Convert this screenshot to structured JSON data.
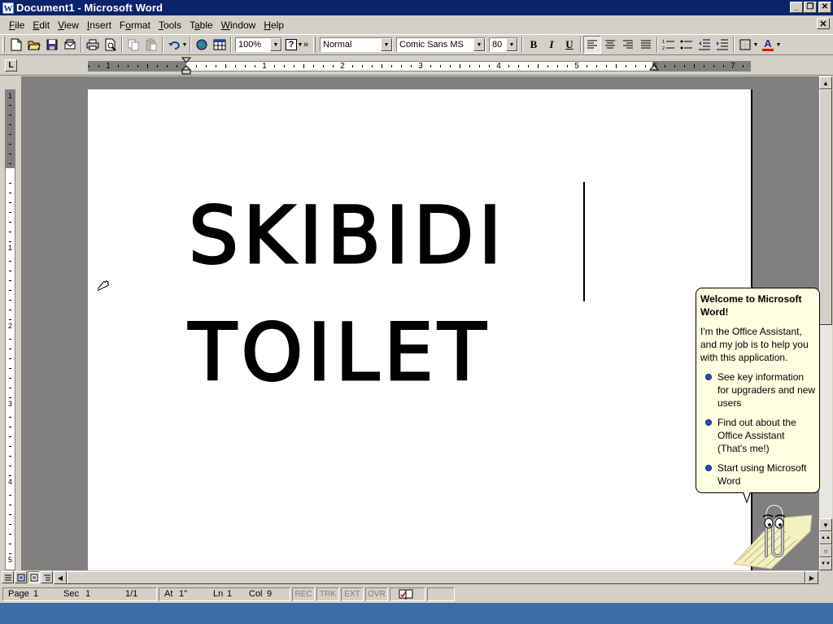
{
  "window": {
    "title": "Document1 - Microsoft Word",
    "app_icon": "W",
    "buttons": {
      "minimize": "_",
      "maximize": "❐",
      "close": "✕"
    }
  },
  "menu": {
    "items": [
      {
        "label": "File",
        "key": "F",
        "rest": "ile"
      },
      {
        "label": "Edit",
        "key": "E",
        "rest": "dit"
      },
      {
        "label": "View",
        "key": "V",
        "rest": "iew"
      },
      {
        "label": "Insert",
        "key": "I",
        "rest": "nsert"
      },
      {
        "label": "Format",
        "key": "F",
        "rest": "ormat",
        "pre": ""
      },
      {
        "label": "Tools",
        "key": "T",
        "rest": "ools"
      },
      {
        "label": "Table",
        "key": "a",
        "pre": "T",
        "rest": "ble"
      },
      {
        "label": "Window",
        "key": "W",
        "rest": "indow"
      },
      {
        "label": "Help",
        "key": "H",
        "rest": "elp"
      }
    ],
    "doc_close": "✕"
  },
  "toolbar": {
    "zoom": "100%",
    "help_glyph": "?",
    "more": "»",
    "style": "Normal",
    "font": "Comic Sans MS",
    "size": "80",
    "bold": "B",
    "italic": "I",
    "underline": "U",
    "font_color_glyph": "A",
    "colors": {
      "font_color": "#ff0000"
    }
  },
  "ruler": {
    "tab_selector": "L",
    "h_numbers": [
      "1",
      "1",
      "2",
      "3",
      "4",
      "5",
      "6",
      "7"
    ],
    "v_numbers": [
      "1",
      "1",
      "2",
      "3",
      "4",
      "5"
    ]
  },
  "document": {
    "line1": "SKIBIDI",
    "line2": "TOILET"
  },
  "status": {
    "page": "Page",
    "page_num": "1",
    "sec": "Sec",
    "sec_num": "1",
    "page_of": "1/1",
    "at": "At",
    "at_val": "1\"",
    "ln": "Ln",
    "ln_val": "1",
    "col": "Col",
    "col_val": "9",
    "rec": "REC",
    "trk": "TRK",
    "ext": "EXT",
    "ovr": "OVR"
  },
  "assistant": {
    "title": "Welcome to Microsoft Word!",
    "body": "I'm the Office Assistant, and my job is to help you with this application.",
    "options": [
      "See key information for upgraders and new users",
      "Find out about the Office Assistant (That's me!)",
      "Start using Microsoft Word"
    ]
  }
}
